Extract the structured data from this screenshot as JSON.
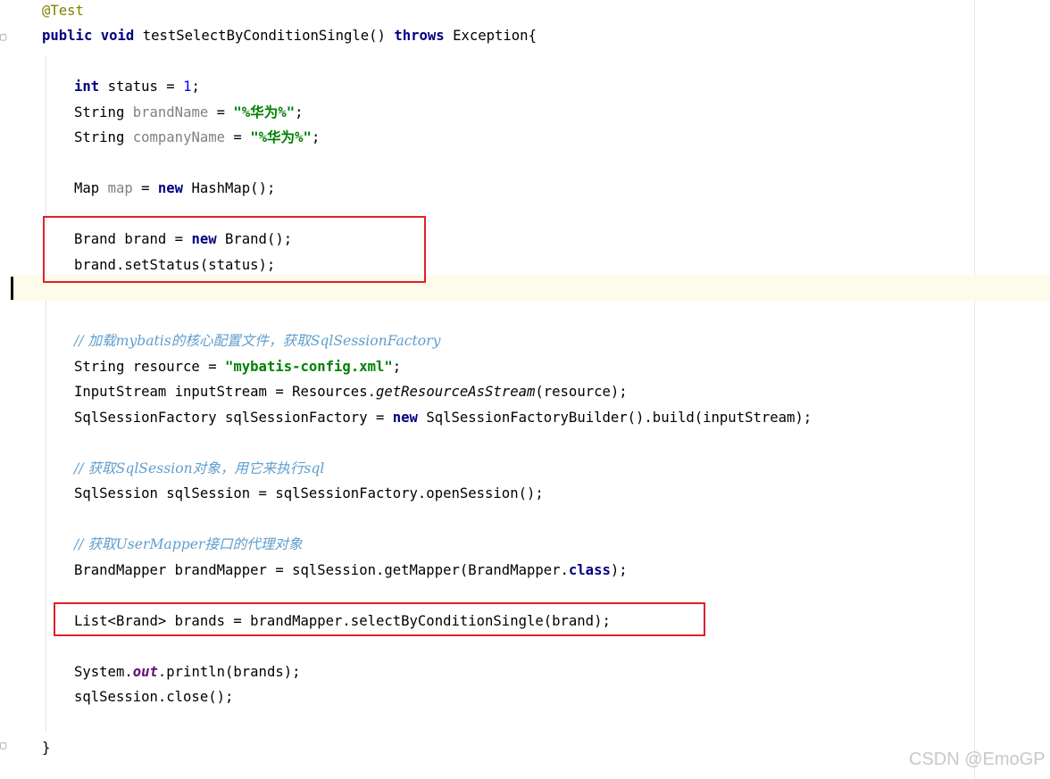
{
  "code": {
    "annotation": "@Test",
    "signature": {
      "kw_public": "public",
      "kw_void": "void",
      "method": "testSelectByConditionSingle()",
      "kw_throws": "throws",
      "rest": "Exception{"
    },
    "status_line": {
      "kw_int": "int",
      "rest": "status = ",
      "num": "1",
      "end": ";"
    },
    "brandname_line": {
      "type": "String",
      "var": "brandName",
      "op": " = ",
      "str": "\"%华为%\"",
      "end": ";"
    },
    "companyname_line": {
      "type": "String",
      "var": "companyName",
      "op": " = ",
      "str": "\"%华为%\"",
      "end": ";"
    },
    "map_line": {
      "type": "Map",
      "var": "map",
      "op": " = ",
      "kw_new": "new",
      "rest": " HashMap();"
    },
    "brand_line": {
      "start": "Brand brand = ",
      "kw_new": "new",
      "rest": " Brand();"
    },
    "setstatus_line": "brand.setStatus(status);",
    "comment1": "// 加载mybatis的核心配置文件，获取SqlSessionFactory",
    "resource_line": {
      "start": "String resource = ",
      "str": "\"mybatis-config.xml\"",
      "end": ";"
    },
    "inputstream_line": {
      "start": "InputStream inputStream = Resources.",
      "method": "getResourceAsStream",
      "rest": "(resource);"
    },
    "factory_line": {
      "start": "SqlSessionFactory sqlSessionFactory = ",
      "kw_new": "new",
      "rest": " SqlSessionFactoryBuilder().build(inputStream);"
    },
    "comment2": "// 获取SqlSession对象，用它来执行sql",
    "session_line": "SqlSession sqlSession = sqlSessionFactory.openSession();",
    "comment3": "// 获取UserMapper接口的代理对象",
    "mapper_line": {
      "start": "BrandMapper brandMapper = sqlSession.getMapper(BrandMapper.",
      "kw_class": "class",
      "end": ");"
    },
    "list_line": "List<Brand> brands = brandMapper.selectByConditionSingle(brand);",
    "println_line": {
      "start": "System.",
      "field": "out",
      "rest": ".println(brands);"
    },
    "close_line": "sqlSession.close();",
    "closing_brace": "}"
  },
  "watermark": "CSDN @EmoGP",
  "colors": {
    "keyword": "#000080",
    "string": "#008000",
    "number": "#0000ff",
    "annotation": "#808000",
    "comment": "#5f9ecd",
    "unused_variable": "#808080",
    "highlight_box": "#e0202a",
    "current_line": "#fdfbe9"
  },
  "icons": [
    "fold-icon",
    "text-caret"
  ]
}
